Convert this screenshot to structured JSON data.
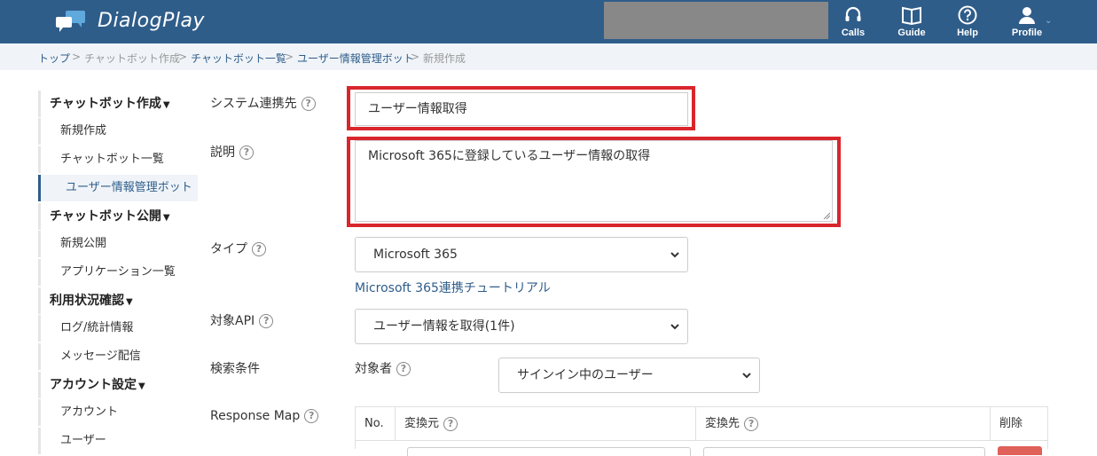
{
  "header": {
    "app_name": "DialogPlay",
    "nav": [
      {
        "label": "Calls",
        "icon": "headset-icon"
      },
      {
        "label": "Guide",
        "icon": "book-icon"
      },
      {
        "label": "Help",
        "icon": "question-circle-icon"
      },
      {
        "label": "Profile",
        "icon": "user-icon"
      }
    ],
    "colors": {
      "bar": "#2f5d8a"
    }
  },
  "breadcrumb": {
    "items": [
      "トップ",
      "チャットボット作成",
      "チャットボット一覧",
      "ユーザー情報管理ボット",
      "新規作成"
    ],
    "separator": ">"
  },
  "sidebar": {
    "groups": [
      {
        "label": "チャットボット作成",
        "items": [
          "新規作成",
          "チャットボット一覧",
          "ユーザー情報管理ボット"
        ]
      },
      {
        "label": "チャットボット公開",
        "items": [
          "新規公開",
          "アプリケーション一覧"
        ]
      },
      {
        "label": "利用状況確認",
        "items": [
          "ログ/統計情報",
          "メッセージ配信"
        ]
      },
      {
        "label": "アカウント設定",
        "items": [
          "アカウント",
          "ユーザー"
        ]
      }
    ],
    "active_item": "ユーザー情報管理ボット"
  },
  "form": {
    "system_label": "システム連携先",
    "system_value": "ユーザー情報取得",
    "description_label": "説明",
    "description_value": "Microsoft 365に登録しているユーザー情報の取得",
    "type_label": "タイプ",
    "type_value": "Microsoft 365",
    "tutorial_link": "Microsoft 365連携チュートリアル",
    "api_label": "対象API",
    "api_value": "ユーザー情報を取得(1件)",
    "search_label": "検索条件",
    "target_label": "対象者",
    "target_value": "サインイン中のユーザー",
    "response_label": "Response Map",
    "table_headers": {
      "no": "No.",
      "source": "変換元",
      "dest": "変換先",
      "delete": "削除"
    },
    "help_glyph": "?",
    "highlight_color": "#d9262c"
  }
}
